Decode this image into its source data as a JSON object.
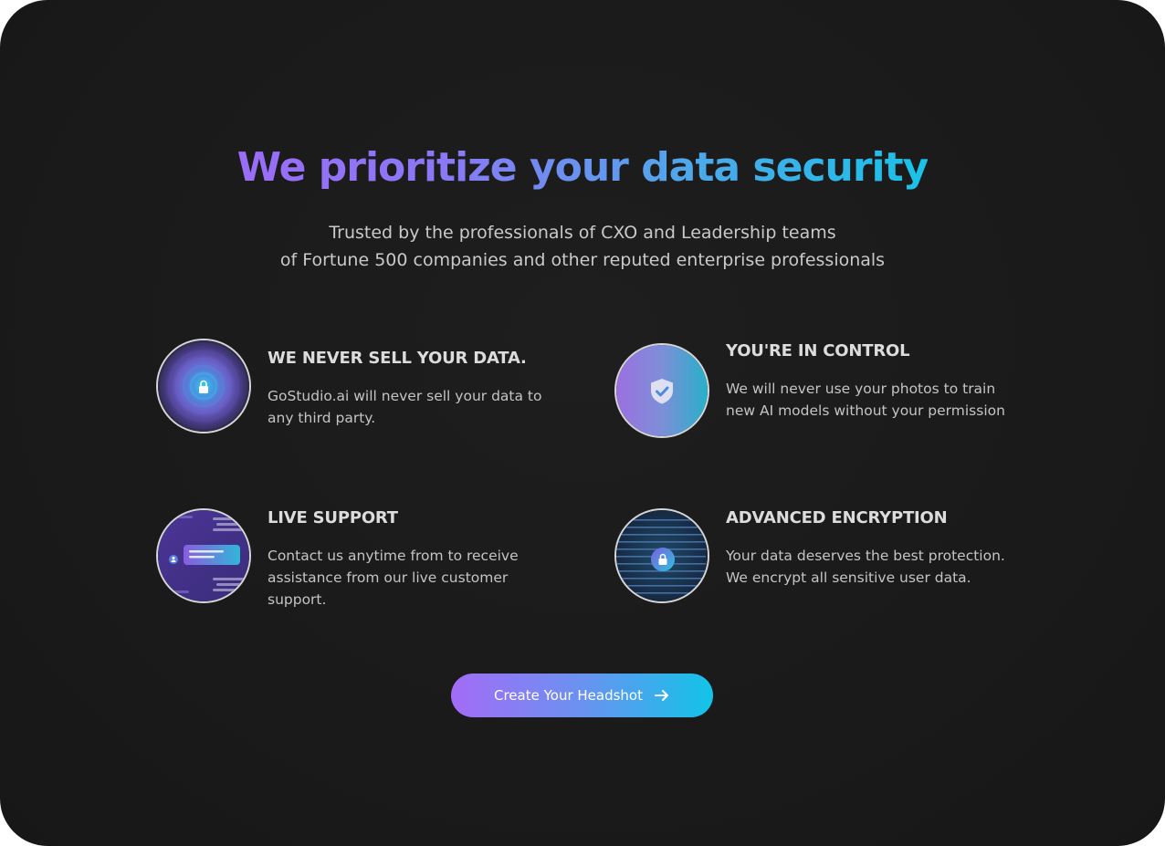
{
  "hero": {
    "title": "We prioritize your data security",
    "subtitle_line1": "Trusted by the professionals of CXO and Leadership teams",
    "subtitle_line2": "of Fortune 500 companies and other reputed enterprise professionals"
  },
  "features": [
    {
      "icon": "lock-icon",
      "title": "WE NEVER SELL YOUR DATA.",
      "description": "GoStudio.ai will never sell your data to any third party."
    },
    {
      "icon": "shield-check-icon",
      "title": "YOU'RE IN CONTROL",
      "description": "We will never use your photos to train new AI models without your permission"
    },
    {
      "icon": "chat-support-icon",
      "title": "LIVE SUPPORT",
      "description": "Contact us anytime from to receive assistance from our live customer support."
    },
    {
      "icon": "encrypted-lock-icon",
      "title": "ADVANCED ENCRYPTION",
      "description": "Your data deserves the best protection. We encrypt all sensitive user data."
    }
  ],
  "cta": {
    "label": "Create Your Headshot",
    "icon": "arrow-right-icon"
  },
  "colors": {
    "background": "#1a1a1a",
    "gradient_start": "#9a6df7",
    "gradient_end": "#19c2e8",
    "text_light": "#dcdcdc"
  }
}
